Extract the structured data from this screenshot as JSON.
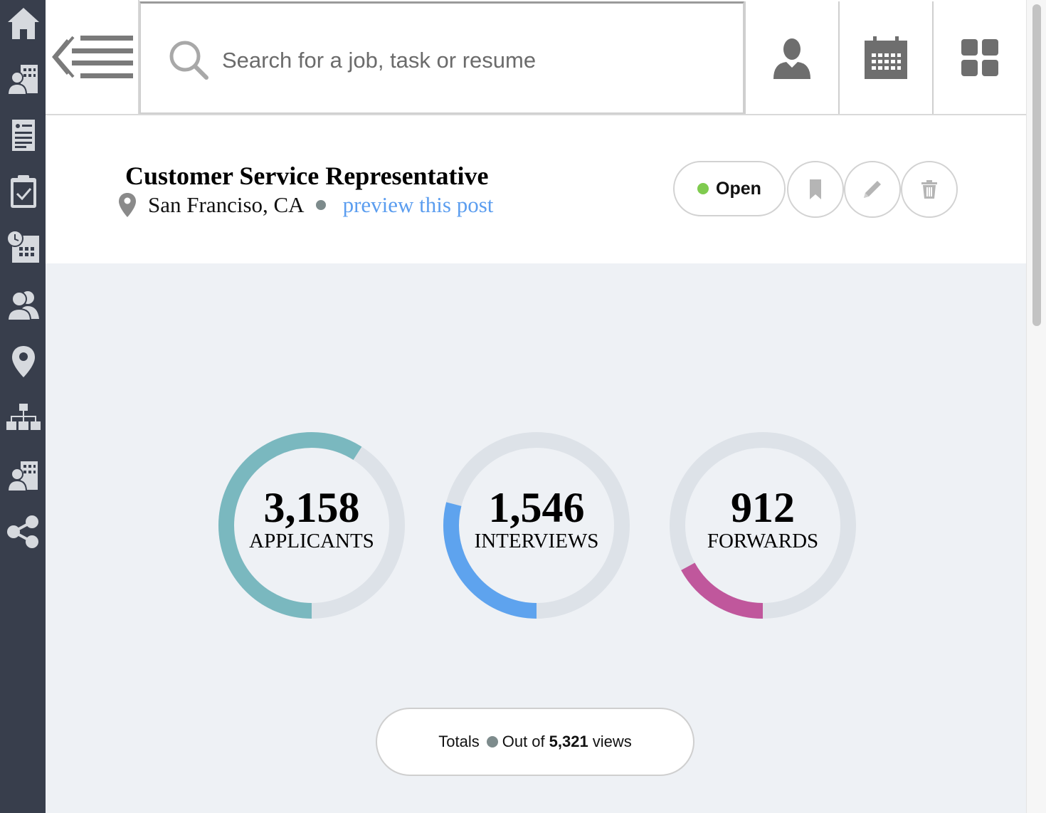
{
  "sidebar": {
    "items": [
      {
        "icon": "home-icon"
      },
      {
        "icon": "company-users-icon"
      },
      {
        "icon": "resume-document-icon"
      },
      {
        "icon": "clipboard-check-icon"
      },
      {
        "icon": "calendar-clock-icon"
      },
      {
        "icon": "contacts-icon"
      },
      {
        "icon": "location-pin-icon"
      },
      {
        "icon": "org-chart-icon"
      },
      {
        "icon": "company-users-icon"
      },
      {
        "icon": "share-icon"
      }
    ]
  },
  "topbar": {
    "search_placeholder": "Search for a job, task or resume",
    "buttons": [
      "user-icon",
      "calendar-icon",
      "grid-icon"
    ]
  },
  "job": {
    "title": "Customer Service Representative",
    "location": "San Franciso, CA",
    "preview_link": "preview this post",
    "status": "Open",
    "status_color": "#7fcb4f"
  },
  "stats": [
    {
      "value": "3,158",
      "label": "APPLICANTS",
      "fraction": 0.59,
      "color": "#7ab8bf"
    },
    {
      "value": "1,546",
      "label": "INTERVIEWS",
      "fraction": 0.29,
      "color": "#5ea3ee"
    },
    {
      "value": "912",
      "label": "FORWARDS",
      "fraction": 0.17,
      "color": "#c0579c"
    }
  ],
  "totals": {
    "label": "Totals",
    "prefix": "Out of",
    "value": "5,321",
    "suffix": "views"
  },
  "colors": {
    "sidebar_bg": "#383e4c",
    "stats_bg": "#eef1f5",
    "track": "#dde2e8",
    "link": "#5b9def"
  }
}
